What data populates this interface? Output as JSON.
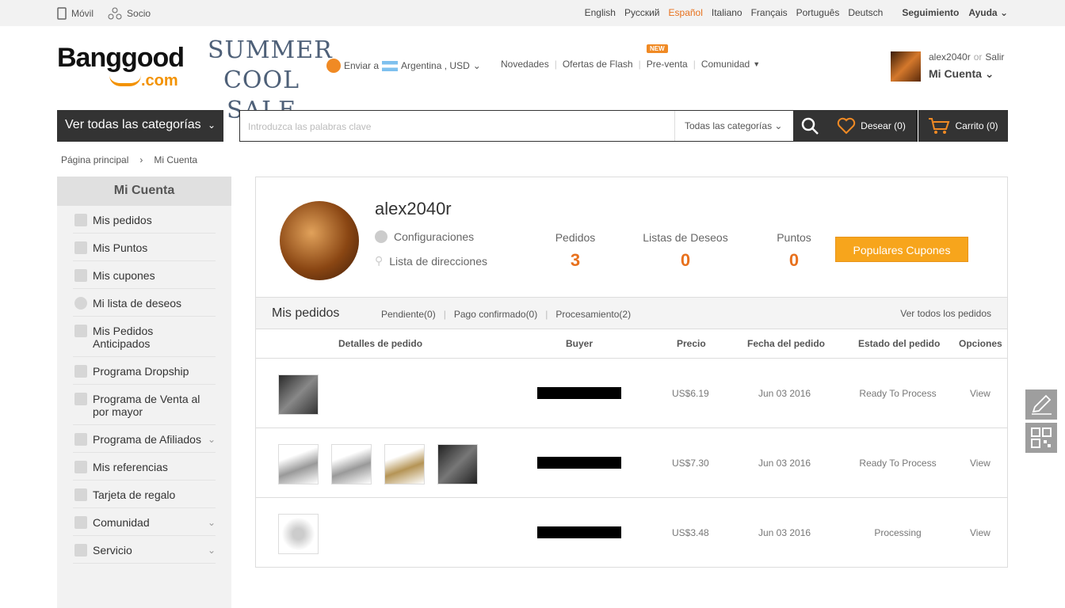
{
  "topbar": {
    "mobile": "Móvil",
    "partner": "Socio",
    "languages": [
      "English",
      "Русский",
      "Español",
      "Italiano",
      "Français",
      "Português",
      "Deutsch"
    ],
    "active_language": "Español",
    "tracking": "Seguimiento",
    "help": "Ayuda"
  },
  "header": {
    "logo_top": "Banggood",
    "logo_bottom": ".com",
    "promo_line1": "SUMMER",
    "promo_line2": "COOL SALE",
    "ship_to_label": "Enviar a",
    "ship_to_value": "Argentina , USD",
    "nav": [
      "Novedades",
      "Ofertas de Flash",
      "Pre-venta",
      "Comunidad"
    ],
    "new_badge": "NEW",
    "username": "alex2040r",
    "or": "or",
    "logout": "Salir",
    "my_account": "Mi Cuenta"
  },
  "search": {
    "all_categories": "Ver todas las categorías",
    "placeholder": "Introduzca las palabras clave",
    "category_select": "Todas las categorías",
    "wishlist": "Desear (0)",
    "cart": "Carrito (0)"
  },
  "breadcrumb": [
    "Página principal",
    "Mi Cuenta"
  ],
  "sidebar": {
    "title": "Mi Cuenta",
    "items": [
      {
        "label": "Mis pedidos",
        "chevron": false
      },
      {
        "label": "Mis Puntos",
        "chevron": false
      },
      {
        "label": "Mis cupones",
        "chevron": false
      },
      {
        "label": "Mi lista de deseos",
        "chevron": false
      },
      {
        "label": "Mis Pedidos Anticipados",
        "chevron": false
      },
      {
        "label": "Programa Dropship",
        "chevron": false
      },
      {
        "label": "Programa de Venta al por mayor",
        "chevron": false
      },
      {
        "label": "Programa de Afiliados",
        "chevron": true
      },
      {
        "label": "Mis referencias",
        "chevron": false
      },
      {
        "label": "Tarjeta de regalo",
        "chevron": false
      },
      {
        "label": "Comunidad",
        "chevron": true
      },
      {
        "label": "Servicio",
        "chevron": true
      }
    ]
  },
  "profile": {
    "username": "alex2040r",
    "settings": "Configuraciones",
    "addresses": "Lista de direcciones",
    "stats": [
      {
        "label": "Pedidos",
        "value": "3"
      },
      {
        "label": "Listas de Deseos",
        "value": "0"
      },
      {
        "label": "Puntos",
        "value": "0"
      }
    ],
    "coupon_button": "Populares Cupones"
  },
  "orders": {
    "title": "Mis pedidos",
    "tabs": [
      "Pendiente(0)",
      "Pago confirmado(0)",
      "Procesamiento(2)"
    ],
    "view_all": "Ver todos los pedidos",
    "columns": [
      "Detalles de pedido",
      "Buyer",
      "Precio",
      "Fecha del pedido",
      "Estado del pedido",
      "Opciones"
    ],
    "rows": [
      {
        "images": 1,
        "price": "US$6.19",
        "date": "Jun 03 2016",
        "status": "Ready To Process",
        "action": "View"
      },
      {
        "images": 4,
        "price": "US$7.30",
        "date": "Jun 03 2016",
        "status": "Ready To Process",
        "action": "View"
      },
      {
        "images": 1,
        "price": "US$3.48",
        "date": "Jun 03 2016",
        "status": "Processing",
        "action": "View"
      }
    ]
  }
}
